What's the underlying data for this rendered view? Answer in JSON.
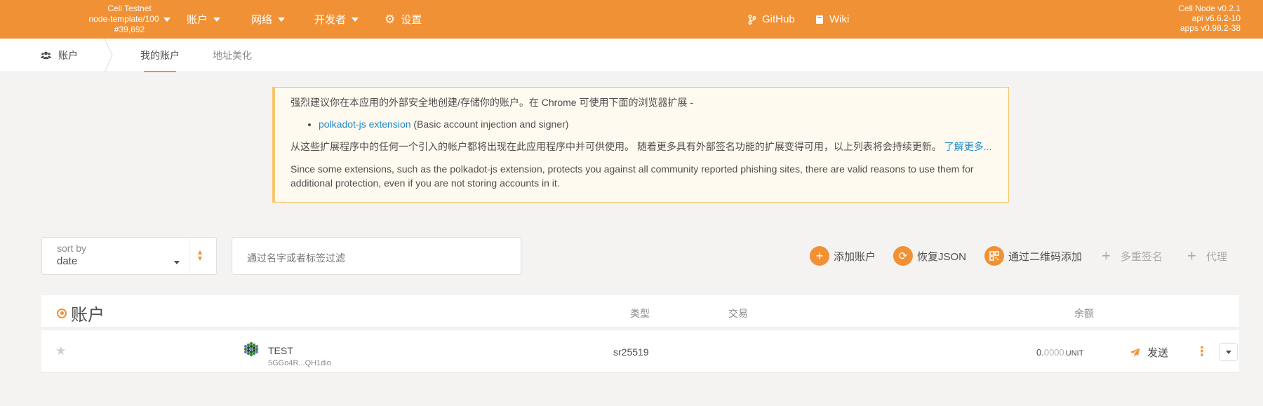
{
  "topbar": {
    "chain_name": "Cell Testnet",
    "node_name": "node-template/100",
    "block": "#39,692",
    "menu": [
      {
        "label": "账户",
        "icon": "caret-down-icon"
      },
      {
        "label": "网络",
        "icon": "caret-down-icon"
      },
      {
        "label": "开发者",
        "icon": "caret-down-icon"
      },
      {
        "label": "设置",
        "icon": "gear-icon"
      }
    ],
    "github_label": "GitHub",
    "wiki_label": "Wiki",
    "versions": [
      "Cell Node v0.2.1",
      "api v6.6.2-10",
      "apps v0.98.2-38"
    ]
  },
  "tabs": {
    "home_label": "账户",
    "items": [
      {
        "label": "我的账户",
        "active": true
      },
      {
        "label": "地址美化",
        "active": false
      }
    ]
  },
  "banner": {
    "line1": "强烈建议你在本应用的外部安全地创建/存储你的账户。在 Chrome 可使用下面的浏览器扩展 -",
    "ext_link": "polkadot-js extension",
    "ext_desc": "(Basic account injection and signer)",
    "line2": "从这些扩展程序中的任何一个引入的帐户都将出现在此应用程序中并可供使用。 随着更多具有外部签名功能的扩展变得可用，以上列表将会持续更新。",
    "learn_more": "了解更多...",
    "line3": "Since some extensions, such as the polkadot-js extension, protects you against all community reported phishing sites, there are valid reasons to use them for additional protection, even if you are not storing accounts in it."
  },
  "filters": {
    "sort_label": "sort by",
    "sort_value": "date",
    "filter_placeholder": "通过名字或者标签过滤"
  },
  "actions": {
    "add_account": "添加账户",
    "restore_json": "恢复JSON",
    "add_qr": "通过二维码添加",
    "multisig": "多重签名",
    "proxy": "代理"
  },
  "table": {
    "title": "账户",
    "col_type": "类型",
    "col_tx": "交易",
    "col_balance": "余额",
    "rows": [
      {
        "name": "TEST",
        "address": "5GGo4R...QH1dio",
        "type": "sr25519",
        "balance_int": "0.",
        "balance_dec": "0000",
        "unit": "UNIT",
        "send_label": "发送"
      }
    ]
  },
  "colors": {
    "accent": "#f19135",
    "banner_border": "#f6c66b",
    "link": "#1a8ad0"
  }
}
